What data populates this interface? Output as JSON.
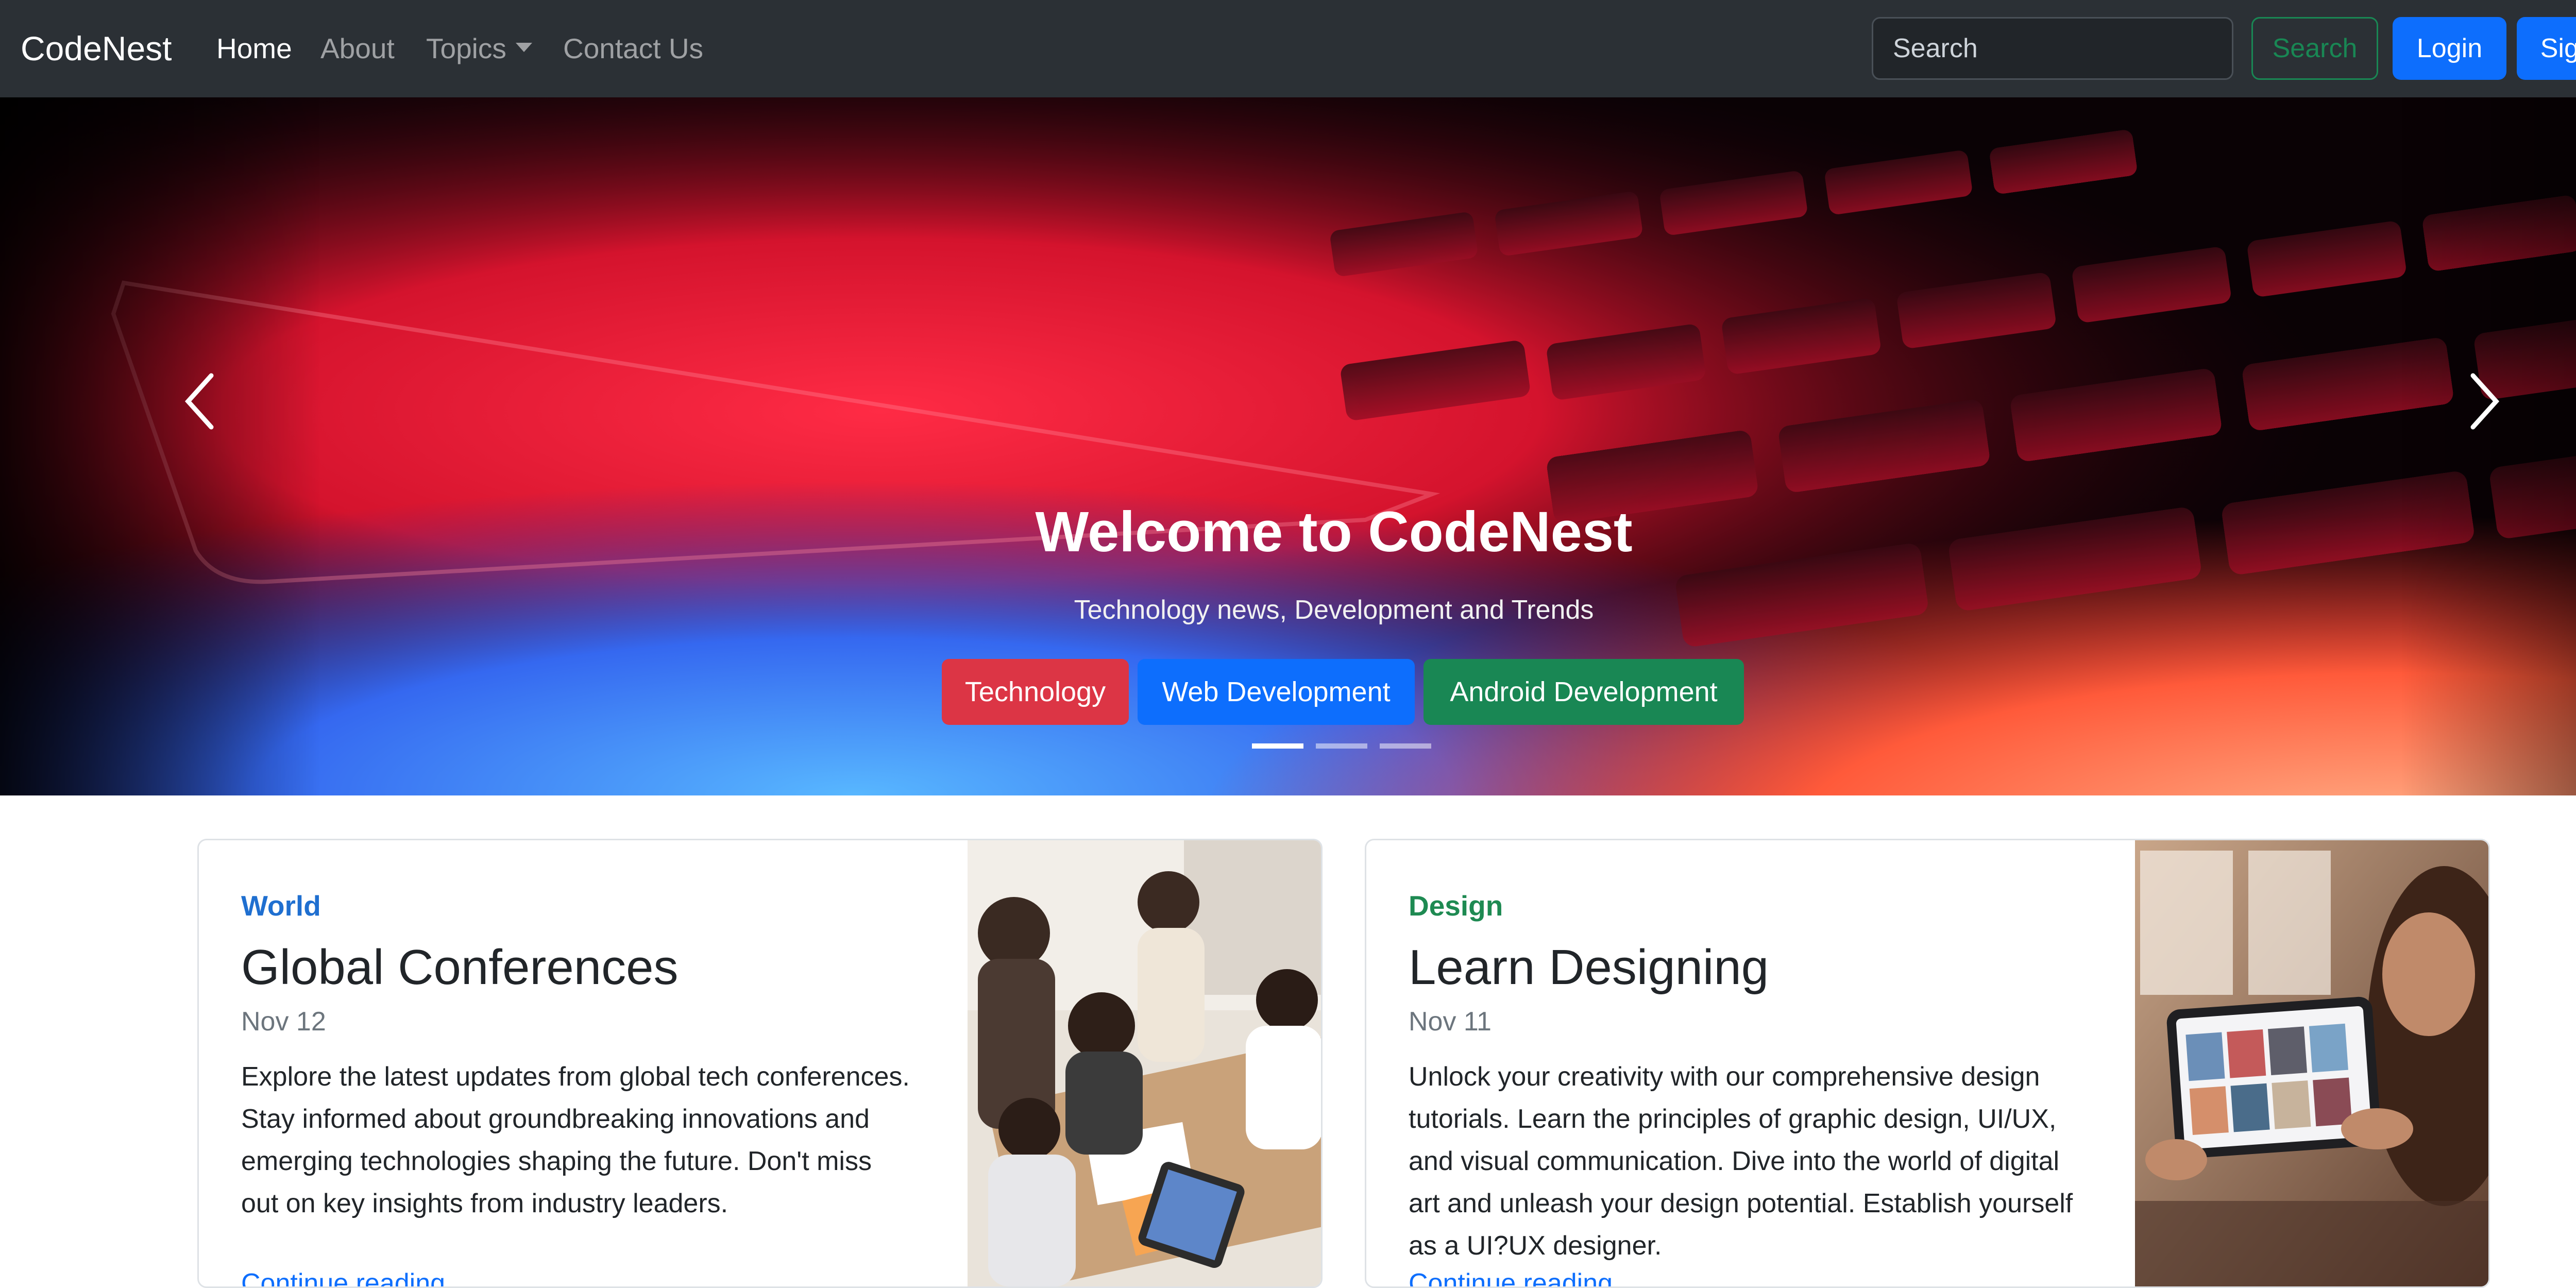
{
  "navbar": {
    "brand": "CodeNest",
    "links": [
      {
        "label": "Home",
        "active": true
      },
      {
        "label": "About",
        "active": false
      },
      {
        "label": "Topics",
        "active": false
      },
      {
        "label": "Contact Us",
        "active": false
      }
    ],
    "search_placeholder": "Search",
    "search_button": "Search",
    "login_button": "Login",
    "signup_button": "SignUp"
  },
  "hero": {
    "title": "Welcome to CodeNest",
    "subtitle": "Technology news, Development and Trends",
    "buttons": [
      {
        "label": "Technology",
        "color": "#dc3545"
      },
      {
        "label": "Web Development",
        "color": "#0d6efd"
      },
      {
        "label": "Android Development",
        "color": "#198754"
      }
    ],
    "slide_count": 3,
    "active_slide": 1,
    "prev_icon": "chevron-left-icon",
    "next_icon": "chevron-right-icon"
  },
  "cards": [
    {
      "category": "World",
      "category_color": "#0d6efd",
      "title": "Global Conferences",
      "date": "Nov 12",
      "text": "Explore the latest updates from global tech conferences. Stay informed about groundbreaking innovations and emerging technologies shaping the future. Don't miss out on key insights from industry leaders.",
      "link": "Continue reading"
    },
    {
      "category": "Design",
      "category_color": "#198754",
      "title": "Learn Designing",
      "date": "Nov 11",
      "text": "Unlock your creativity with our comprehensive design tutorials. Learn the principles of graphic design, UI/UX, and visual communication. Dive into the world of digital art and unleash your design potential. Establish yourself as a UI?UX designer.",
      "link": "Continue reading"
    }
  ],
  "colors": {
    "navbar_bg": "#2b3035",
    "primary": "#0d6efd",
    "success": "#198754",
    "danger": "#dc3545"
  }
}
